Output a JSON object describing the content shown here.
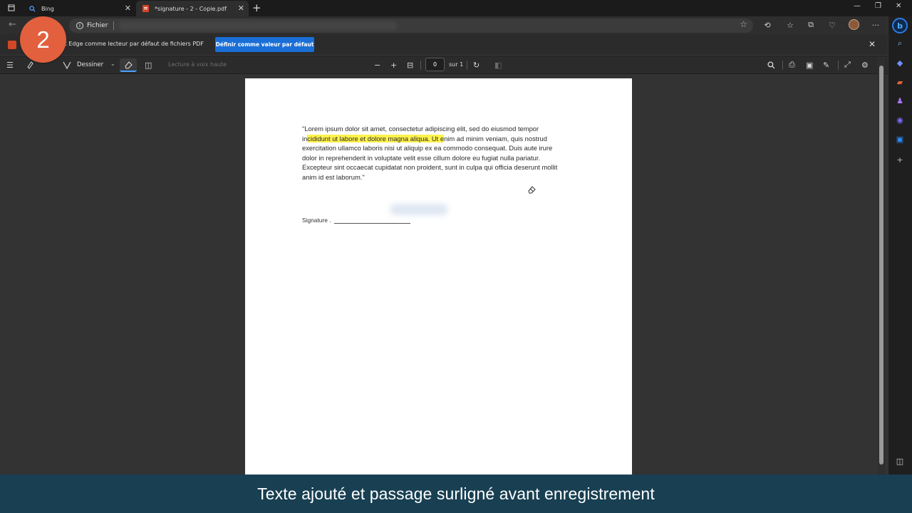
{
  "browser": {
    "tabs": [
      {
        "title": "Bing",
        "icon": "search-icon"
      },
      {
        "title": "*signature - 2 - Copie.pdf",
        "icon": "pdf-icon"
      }
    ],
    "address": {
      "chip_label": "Fichier"
    }
  },
  "infobar": {
    "message_visible": "ft Edge comme lecteur par défaut de fichiers PDF",
    "button_label": "Définir comme valeur par défaut"
  },
  "pdf_toolbar": {
    "draw_label": "Dessiner",
    "read_aloud_label": "Lecture à voix haute",
    "page_current": "0",
    "page_total": "sur 1"
  },
  "document": {
    "lines": [
      {
        "pre": "\"Lorem ipsum dolor sit amet, consectetur adipiscing elit, sed do eiusmod tempor",
        "hl": "",
        "post": ""
      },
      {
        "pre": "in",
        "hl": "cididunt ut labore et dolore magna aliqua. Ut e",
        "post": "nim ad minim veniam, quis nostrud"
      },
      {
        "pre": "exercitation ullamco laboris nisi ut aliquip ex ea commodo consequat. Duis aute irure",
        "hl": "",
        "post": ""
      },
      {
        "pre": "dolor in reprehenderit in voluptate velit esse cillum dolore eu fugiat nulla pariatur.",
        "hl": "",
        "post": ""
      },
      {
        "pre": "Excepteur sint occaecat cupidatat non proident, sunt in culpa qui officia deserunt mollit",
        "hl": "",
        "post": ""
      },
      {
        "pre": "anim id est laborum.\"",
        "hl": "",
        "post": ""
      }
    ],
    "signature_label": "Signature ."
  },
  "overlay": {
    "step_number": "2",
    "caption": "Texte ajouté et passage surligné avant enregistrement"
  },
  "colors": {
    "highlight": "#fff24d",
    "accent": "#1a6fd6",
    "badge": "#e2603e",
    "caption_bg": "#184256"
  }
}
